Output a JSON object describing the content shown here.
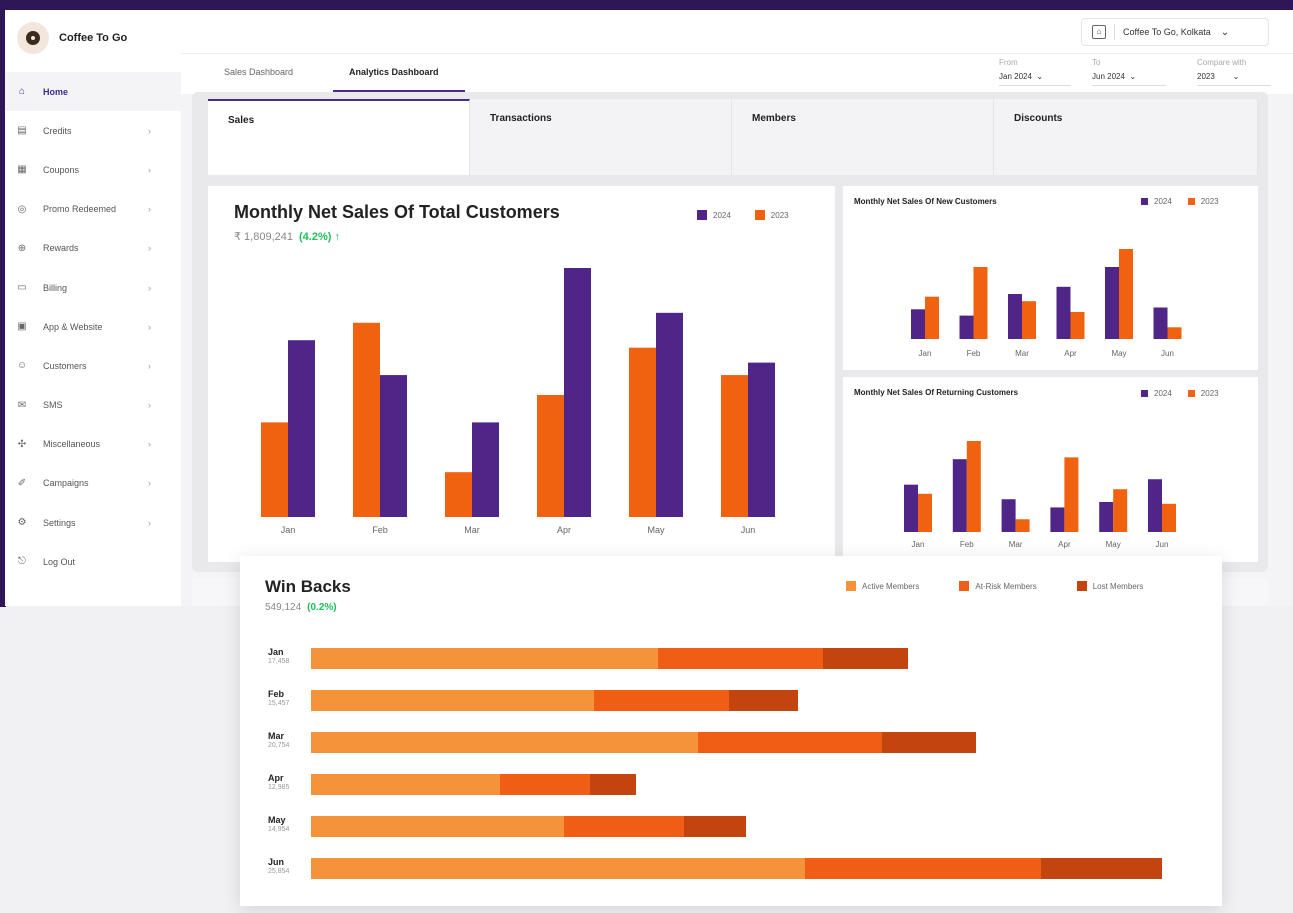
{
  "brand": {
    "name": "Coffee To Go"
  },
  "sidebar": {
    "items": [
      {
        "label": "Home",
        "icon": "home-icon",
        "glyph": "⌂",
        "chevron": false,
        "active": true
      },
      {
        "label": "Credits",
        "icon": "credits-icon",
        "glyph": "▤",
        "chevron": true
      },
      {
        "label": "Coupons",
        "icon": "coupon-icon",
        "glyph": "▦",
        "chevron": true
      },
      {
        "label": "Promo Redeemed",
        "icon": "promo-icon",
        "glyph": "◎",
        "chevron": true
      },
      {
        "label": "Rewards",
        "icon": "rewards-icon",
        "glyph": "⊕",
        "chevron": true
      },
      {
        "label": "Billing",
        "icon": "billing-icon",
        "glyph": "▭",
        "chevron": true
      },
      {
        "label": "App & Website",
        "icon": "app-icon",
        "glyph": "▣",
        "chevron": true
      },
      {
        "label": "Customers",
        "icon": "customers-icon",
        "glyph": "☺",
        "chevron": true
      },
      {
        "label": "SMS",
        "icon": "sms-icon",
        "glyph": "✉",
        "chevron": true
      },
      {
        "label": "Miscellaneous",
        "icon": "misc-icon",
        "glyph": "✣",
        "chevron": true
      },
      {
        "label": "Campaigns",
        "icon": "campaigns-icon",
        "glyph": "✐",
        "chevron": true
      },
      {
        "label": "Settings",
        "icon": "settings-icon",
        "glyph": "⚙",
        "chevron": true
      },
      {
        "label": "Log Out",
        "icon": "logout-icon",
        "glyph": "⎋",
        "chevron": false
      }
    ]
  },
  "header": {
    "location": "Coffee To Go, Kolkata"
  },
  "dashboard_tabs": [
    "Sales Dashboard",
    "Analytics Dashboard"
  ],
  "filters": {
    "from_label": "From",
    "from_value": "Jan 2024",
    "to_label": "To",
    "to_value": "Jun 2024",
    "compare_label": "Compare with",
    "compare_value": "2023"
  },
  "metric_tabs": [
    "Sales",
    "Transactions",
    "Members",
    "Discounts"
  ],
  "colors": {
    "purple": "#4f2688",
    "orange": "#f0620f",
    "active": "#f5933a",
    "atrisk": "#ef5e14",
    "lost": "#c2440f"
  },
  "main_chart": {
    "title": "Monthly Net Sales Of Total Customers",
    "total": "₹ 1,809,241",
    "change": "(4.2%) ↑"
  },
  "new_chart": {
    "title": "Monthly Net Sales Of New Customers"
  },
  "returning_chart": {
    "title": "Monthly Net Sales Of Returning Customers"
  },
  "legend_2024": "2024",
  "legend_2023": "2023",
  "winbacks": {
    "title": "Win Backs",
    "total": "549,124",
    "change": "(0.2%)",
    "legend": [
      "Active Members",
      "At-Risk Members",
      "Lost Members"
    ],
    "rows": [
      {
        "month": "Jan",
        "count": "17,458"
      },
      {
        "month": "Feb",
        "count": "15,457"
      },
      {
        "month": "Mar",
        "count": "20,754"
      },
      {
        "month": "Apr",
        "count": "12,985"
      },
      {
        "month": "May",
        "count": "14,954"
      },
      {
        "month": "Jun",
        "count": "25,854"
      }
    ]
  },
  "chart_data": [
    {
      "type": "bar",
      "title": "Monthly Net Sales Of Total Customers",
      "categories": [
        "Jan",
        "Feb",
        "Mar",
        "Apr",
        "May",
        "Jun"
      ],
      "series": [
        {
          "name": "2023",
          "values": [
            38,
            78,
            18,
            49,
            68,
            57
          ]
        },
        {
          "name": "2024",
          "values": [
            71,
            57,
            38,
            100,
            82,
            62
          ]
        }
      ],
      "ylim": [
        0,
        100
      ]
    },
    {
      "type": "bar",
      "title": "Monthly Net Sales Of New Customers",
      "categories": [
        "Jan",
        "Feb",
        "Mar",
        "Apr",
        "May",
        "Jun"
      ],
      "series": [
        {
          "name": "2024",
          "values": [
            33,
            26,
            50,
            58,
            80,
            35
          ]
        },
        {
          "name": "2023",
          "values": [
            47,
            80,
            42,
            30,
            100,
            13
          ]
        }
      ],
      "ylim": [
        0,
        100
      ]
    },
    {
      "type": "bar",
      "title": "Monthly Net Sales Of Returning Customers",
      "categories": [
        "Jan",
        "Feb",
        "Mar",
        "Apr",
        "May",
        "Jun"
      ],
      "series": [
        {
          "name": "2024",
          "values": [
            52,
            80,
            36,
            27,
            33,
            58
          ]
        },
        {
          "name": "2023",
          "values": [
            42,
            100,
            14,
            82,
            47,
            31
          ]
        }
      ],
      "ylim": [
        0,
        100
      ]
    },
    {
      "type": "bar",
      "title": "Win Backs",
      "orientation": "horizontal",
      "stacked": true,
      "categories": [
        "Jan",
        "Feb",
        "Mar",
        "Apr",
        "May",
        "Jun"
      ],
      "series": [
        {
          "name": "Active Members",
          "values": [
            347,
            283,
            387,
            189,
            253,
            494
          ]
        },
        {
          "name": "At-Risk Members",
          "values": [
            165,
            135,
            184,
            90,
            120,
            236
          ]
        },
        {
          "name": "Lost Members",
          "values": [
            85,
            69,
            94,
            46,
            62,
            121
          ]
        }
      ]
    }
  ]
}
